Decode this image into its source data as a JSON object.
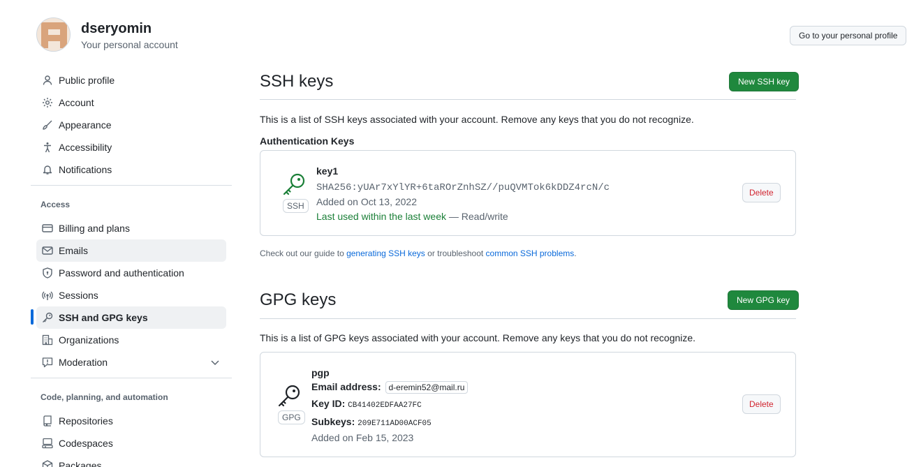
{
  "user": {
    "name": "dseryomin",
    "subtitle": "Your personal account",
    "profile_button": "Go to your personal profile"
  },
  "sidebar": {
    "items_top": [
      {
        "label": "Public profile",
        "icon": "person-icon"
      },
      {
        "label": "Account",
        "icon": "gear-icon"
      },
      {
        "label": "Appearance",
        "icon": "paintbrush-icon"
      },
      {
        "label": "Accessibility",
        "icon": "accessibility-icon"
      },
      {
        "label": "Notifications",
        "icon": "bell-icon"
      }
    ],
    "access_heading": "Access",
    "items_access": [
      {
        "label": "Billing and plans",
        "icon": "credit-card-icon"
      },
      {
        "label": "Emails",
        "icon": "mail-icon"
      },
      {
        "label": "Password and authentication",
        "icon": "shield-lock-icon"
      },
      {
        "label": "Sessions",
        "icon": "broadcast-icon"
      },
      {
        "label": "SSH and GPG keys",
        "icon": "key-icon",
        "selected": true
      },
      {
        "label": "Organizations",
        "icon": "organization-icon"
      },
      {
        "label": "Moderation",
        "icon": "report-icon"
      }
    ],
    "code_heading": "Code, planning, and automation",
    "items_code": [
      {
        "label": "Repositories",
        "icon": "repo-icon"
      },
      {
        "label": "Codespaces",
        "icon": "codespaces-icon"
      },
      {
        "label": "Packages",
        "icon": "package-icon"
      }
    ]
  },
  "ssh": {
    "title": "SSH keys",
    "new_button": "New SSH key",
    "description": "This is a list of SSH keys associated with your account. Remove any keys that you do not recognize.",
    "auth_heading": "Authentication Keys",
    "key": {
      "badge": "SSH",
      "title": "key1",
      "fingerprint": "SHA256:yUAr7xYlYR+6taROrZnhSZ//puQVMTok6kDDZ4rcN/c",
      "added": "Added on Oct 13, 2022",
      "last_used": "Last used within the last week",
      "access": " — Read/write",
      "delete": "Delete"
    },
    "guide": {
      "prefix": "Check out our guide to ",
      "link1": "generating SSH keys",
      "middle": " or troubleshoot ",
      "link2": "common SSH problems",
      "suffix": "."
    }
  },
  "gpg": {
    "title": "GPG keys",
    "new_button": "New GPG key",
    "description": "This is a list of GPG keys associated with your account. Remove any keys that you do not recognize.",
    "key": {
      "badge": "GPG",
      "title": "pgp",
      "email_label": "Email address:",
      "email": "d-eremin52@mail.ru",
      "keyid_label": "Key ID:",
      "keyid": "CB41402EDFAA27FC",
      "subkeys_label": "Subkeys:",
      "subkeys": "209E711AD00ACF05",
      "added": "Added on Feb 15, 2023",
      "delete": "Delete"
    }
  },
  "colors": {
    "accent": "#0969da",
    "green_button": "#1f883d",
    "danger": "#d1242f",
    "success_text": "#1a7f37"
  }
}
